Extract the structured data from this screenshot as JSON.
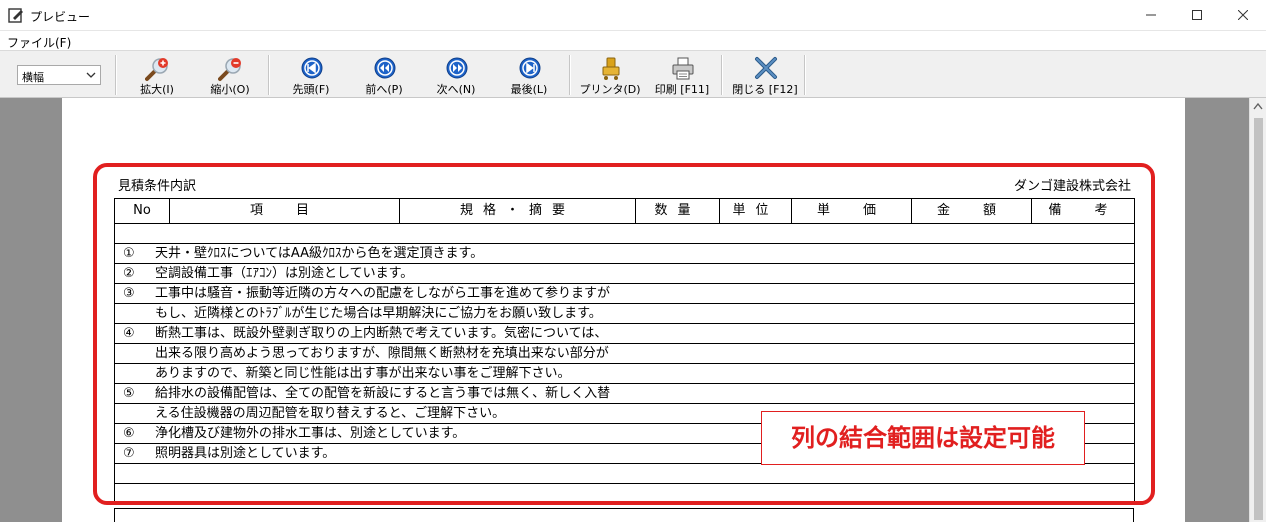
{
  "window": {
    "title": "プレビュー",
    "min_glyph": "—",
    "max_glyph": "☐",
    "close_glyph": "✕"
  },
  "menu": {
    "file": "ファイル(F)"
  },
  "toolbar": {
    "zoom_mode": "横幅",
    "buttons": [
      {
        "label": "拡大(I)",
        "icon": "zoom-in-icon"
      },
      {
        "label": "縮小(O)",
        "icon": "zoom-out-icon"
      },
      {
        "label": "先頭(F)",
        "icon": "first-page-icon"
      },
      {
        "label": "前へ(P)",
        "icon": "previous-page-icon"
      },
      {
        "label": "次へ(N)",
        "icon": "next-page-icon"
      },
      {
        "label": "最後(L)",
        "icon": "last-page-icon"
      },
      {
        "label": "プリンタ(D)",
        "icon": "printer-setup-icon"
      },
      {
        "label": "印刷 [F11]",
        "icon": "print-icon"
      },
      {
        "label": "閉じる [F12]",
        "icon": "close-x-icon"
      }
    ]
  },
  "document": {
    "title": "見積条件内訳",
    "company": "ダンゴ建設株式会社",
    "headers": [
      "No",
      "項　目",
      "規格・摘要",
      "数量",
      "単位",
      "単　価",
      "金　額",
      "備　考"
    ],
    "rows": [
      {
        "num": "",
        "text": ""
      },
      {
        "num": "①",
        "text": "天井・壁ｸﾛｽについてはAA級ｸﾛｽから色を選定頂きます。"
      },
      {
        "num": "②",
        "text": "空調設備工事（ｴｱｺﾝ）は別途としています。"
      },
      {
        "num": "③",
        "text": "工事中は騒音・振動等近隣の方々への配慮をしながら工事を進めて参りますが"
      },
      {
        "num": "",
        "text": "もし、近隣様とのﾄﾗﾌﾞﾙが生じた場合は早期解決にご協力をお願い致します。"
      },
      {
        "num": "④",
        "text": "断熱工事は、既設外壁剥ぎ取りの上内断熱で考えています。気密については、"
      },
      {
        "num": "",
        "text": "出来る限り高めよう思っておりますが、隙間無く断熱材を充填出来ない部分が"
      },
      {
        "num": "",
        "text": "ありますので、新築と同じ性能は出す事が出来ない事をご理解下さい。"
      },
      {
        "num": "⑤",
        "text": "給排水の設備配管は、全ての配管を新設にすると言う事では無く、新しく入替"
      },
      {
        "num": "",
        "text": "える住設機器の周辺配管を取り替えすると、ご理解下さい。"
      },
      {
        "num": "⑥",
        "text": "浄化槽及び建物外の排水工事は、別途としています。"
      },
      {
        "num": "⑦",
        "text": "照明器具は別途としています。"
      },
      {
        "num": "",
        "text": ""
      },
      {
        "num": "",
        "text": ""
      }
    ]
  },
  "callout": "列の結合範囲は設定可能",
  "colors": {
    "accent": "#e11f1f",
    "nav_blue": "#1e63c8"
  }
}
